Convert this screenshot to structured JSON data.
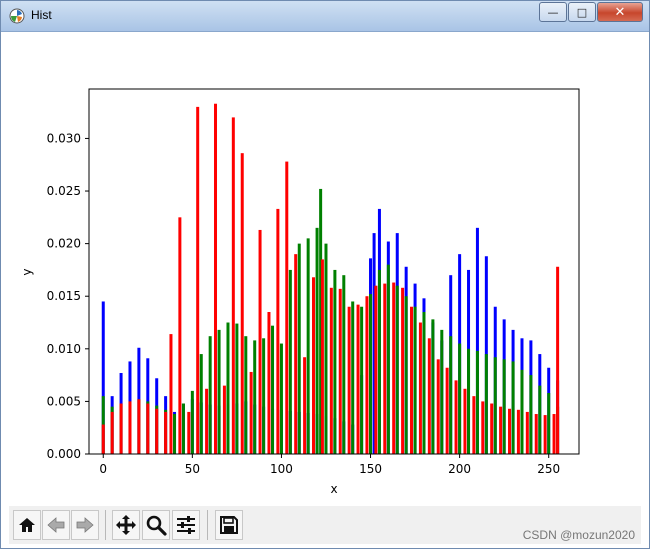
{
  "window": {
    "title": "Hist",
    "app_icon": "matplotlib-icon"
  },
  "titlebar_buttons": [
    {
      "name": "minimize-icon",
      "glyph": "—"
    },
    {
      "name": "maximize-icon",
      "glyph": "□"
    },
    {
      "name": "close-icon",
      "glyph": "✕"
    }
  ],
  "toolbar": {
    "buttons": [
      {
        "name": "home-icon"
      },
      {
        "name": "back-arrow-icon"
      },
      {
        "name": "forward-arrow-icon"
      },
      {
        "name": "pan-move-icon"
      },
      {
        "name": "zoom-magnifier-icon"
      },
      {
        "name": "configure-subplots-icon"
      },
      {
        "name": "save-floppy-icon"
      }
    ]
  },
  "watermark": "CSDN @mozun2020",
  "colors": {
    "blue": "#0000ff",
    "green": "#008000",
    "red": "#ff0000"
  },
  "chart_data": {
    "type": "bar",
    "title": "",
    "xlabel": "x",
    "ylabel": "y",
    "xlim": [
      -8,
      267
    ],
    "ylim": [
      0,
      0.0347
    ],
    "xticks": [
      0,
      50,
      100,
      150,
      200,
      250
    ],
    "yticks": [
      0.0,
      0.005,
      0.01,
      0.015,
      0.02,
      0.025,
      0.03
    ],
    "ytick_labels": [
      "0.000",
      "0.005",
      "0.010",
      "0.015",
      "0.020",
      "0.025",
      "0.030"
    ],
    "grid": false,
    "legend": false,
    "series": [
      {
        "color": "#0000ff",
        "x": [
          0,
          5,
          10,
          15,
          20,
          25,
          30,
          35,
          40,
          45,
          50,
          55,
          60,
          65,
          70,
          75,
          80,
          85,
          90,
          95,
          100,
          105,
          110,
          115,
          120,
          125,
          130,
          135,
          140,
          145,
          150,
          152,
          155,
          160,
          165,
          170,
          175,
          180,
          185,
          190,
          195,
          200,
          205,
          210,
          215,
          220,
          225,
          230,
          235,
          240,
          245,
          250,
          255
        ],
        "values": [
          0.0145,
          0.0055,
          0.0077,
          0.0088,
          0.0101,
          0.0091,
          0.0072,
          0.0055,
          0.004,
          0.0048,
          0.0052,
          0.0049,
          0.0047,
          0.0046,
          0.0047,
          0.0048,
          0.005,
          0.0047,
          0.0045,
          0.0043,
          0.0042,
          0.0041,
          0.004,
          0.0039,
          0.0038,
          0.0036,
          0.0034,
          0.0031,
          0.0028,
          0.0075,
          0.0186,
          0.021,
          0.0233,
          0.0202,
          0.021,
          0.0178,
          0.0162,
          0.0148,
          0.0125,
          0.0108,
          0.017,
          0.019,
          0.0175,
          0.0215,
          0.0188,
          0.014,
          0.0128,
          0.0118,
          0.011,
          0.0108,
          0.0095,
          0.0082,
          0.007
        ]
      },
      {
        "color": "#008000",
        "x": [
          0,
          5,
          10,
          15,
          20,
          25,
          30,
          35,
          40,
          45,
          50,
          55,
          60,
          65,
          70,
          75,
          80,
          85,
          90,
          95,
          100,
          105,
          110,
          115,
          120,
          122,
          125,
          130,
          135,
          140,
          145,
          150,
          155,
          160,
          165,
          170,
          175,
          180,
          185,
          190,
          195,
          200,
          205,
          210,
          215,
          220,
          225,
          230,
          235,
          240,
          245,
          250,
          255
        ],
        "values": [
          0.0055,
          0.0045,
          0.0048,
          0.005,
          0.0052,
          0.005,
          0.0046,
          0.0042,
          0.0038,
          0.0048,
          0.006,
          0.0095,
          0.0112,
          0.0118,
          0.0125,
          0.0124,
          0.0112,
          0.0108,
          0.011,
          0.0122,
          0.0105,
          0.0175,
          0.02,
          0.0205,
          0.0215,
          0.0252,
          0.02,
          0.0175,
          0.017,
          0.0145,
          0.014,
          0.0152,
          0.0175,
          0.018,
          0.016,
          0.015,
          0.014,
          0.0135,
          0.0128,
          0.0118,
          0.0112,
          0.0105,
          0.01,
          0.0098,
          0.0095,
          0.0092,
          0.009,
          0.0088,
          0.008,
          0.0075,
          0.0065,
          0.0058,
          0.0045
        ]
      },
      {
        "color": "#ff0000",
        "x": [
          0,
          5,
          10,
          15,
          20,
          25,
          30,
          35,
          38,
          43,
          48,
          53,
          58,
          63,
          68,
          73,
          78,
          83,
          88,
          93,
          98,
          103,
          108,
          113,
          118,
          123,
          128,
          133,
          138,
          143,
          148,
          153,
          158,
          163,
          168,
          173,
          178,
          183,
          188,
          193,
          198,
          203,
          208,
          213,
          218,
          223,
          228,
          233,
          238,
          243,
          248,
          253,
          255
        ],
        "values": [
          0.0028,
          0.004,
          0.0048,
          0.005,
          0.0052,
          0.0048,
          0.0043,
          0.004,
          0.0114,
          0.0225,
          0.004,
          0.033,
          0.0062,
          0.0333,
          0.0065,
          0.032,
          0.0286,
          0.0078,
          0.0213,
          0.0135,
          0.0233,
          0.0278,
          0.019,
          0.0092,
          0.0168,
          0.0185,
          0.0158,
          0.0157,
          0.014,
          0.0142,
          0.015,
          0.016,
          0.0162,
          0.0163,
          0.0158,
          0.014,
          0.0125,
          0.011,
          0.009,
          0.0082,
          0.007,
          0.0062,
          0.0055,
          0.005,
          0.0048,
          0.0045,
          0.0043,
          0.0042,
          0.004,
          0.0038,
          0.0037,
          0.0038,
          0.0178
        ]
      }
    ]
  }
}
